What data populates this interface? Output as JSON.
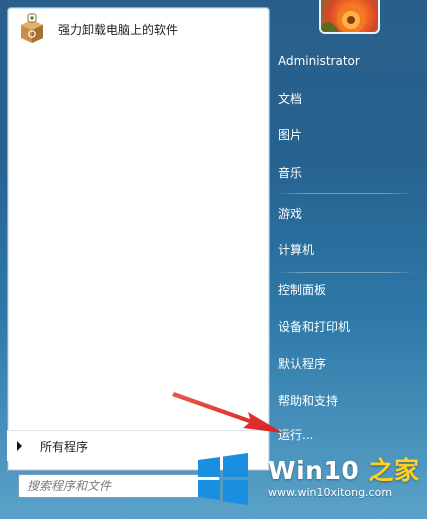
{
  "pinned": {
    "label": "强力卸载电脑上的软件",
    "icon": "uninstall-box-icon"
  },
  "all_programs": {
    "label": "所有程序",
    "icon": "triangle-right-icon"
  },
  "search": {
    "placeholder": "搜索程序和文件"
  },
  "user": {
    "name": "Administrator",
    "picture": "flower-avatar"
  },
  "right_items": {
    "documents": "文档",
    "pictures": "图片",
    "music": "音乐",
    "games": "游戏",
    "computer": "计算机",
    "control_panel": "控制面板",
    "devices_printers": "设备和打印机",
    "default_programs": "默认程序",
    "help_support": "帮助和支持",
    "run": "运行..."
  },
  "watermark": {
    "title_a": "Win10",
    "title_b": " 之家",
    "url": "www.win10xitong.com"
  },
  "colors": {
    "accent_red": "#e0312f",
    "win_logo_blue": "#1a8fe0",
    "watermark_yellow": "#ffd21f"
  }
}
